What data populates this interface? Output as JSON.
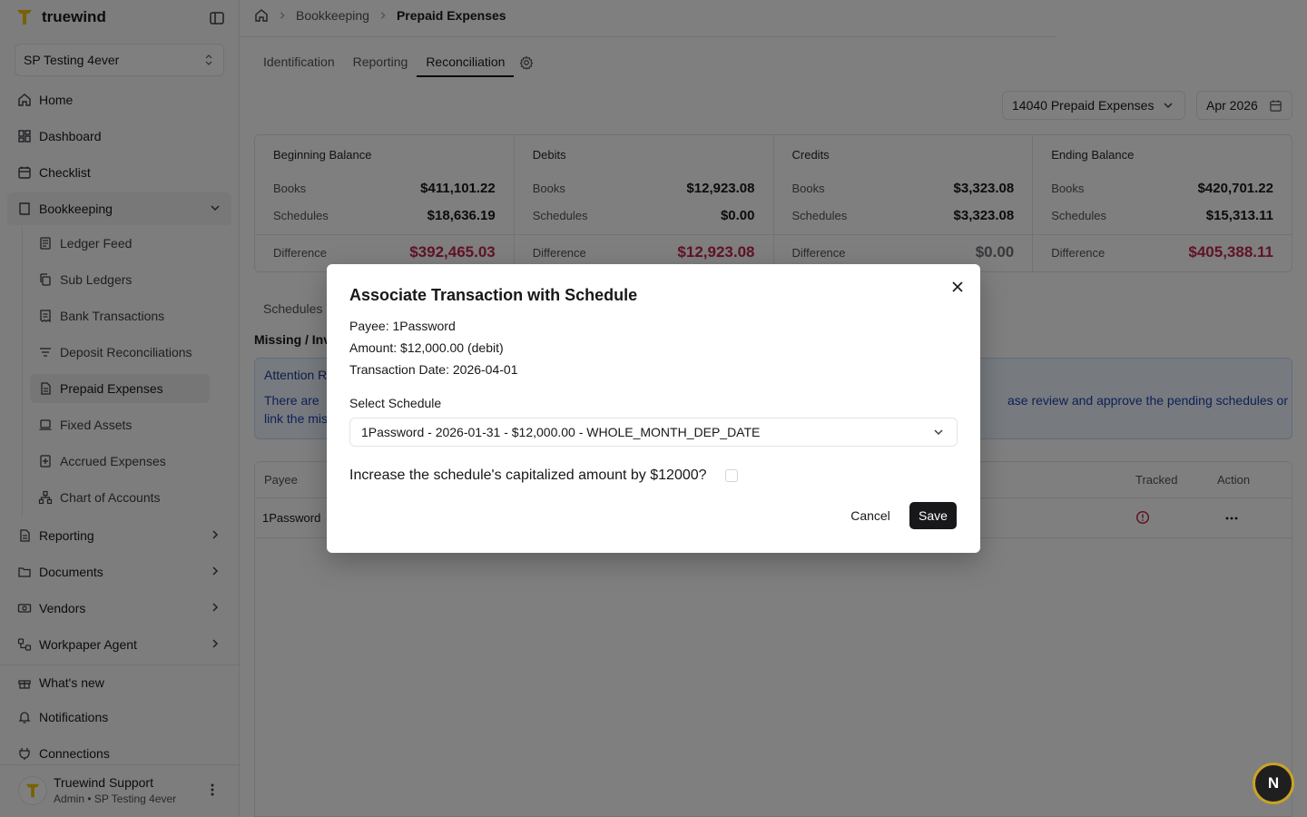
{
  "app": {
    "brand": "truewind"
  },
  "org_selector": {
    "value": "SP Testing 4ever"
  },
  "sidebar": {
    "items": [
      {
        "label": "Home",
        "icon": "home-icon"
      },
      {
        "label": "Dashboard",
        "icon": "dashboard-icon"
      },
      {
        "label": "Checklist",
        "icon": "calendar-icon"
      },
      {
        "label": "Bookkeeping",
        "icon": "book-icon"
      }
    ],
    "bookkeeping_sub": [
      {
        "label": "Ledger Feed"
      },
      {
        "label": "Sub Ledgers"
      },
      {
        "label": "Bank Transactions"
      },
      {
        "label": "Deposit Reconciliations"
      },
      {
        "label": "Prepaid Expenses"
      },
      {
        "label": "Fixed Assets"
      },
      {
        "label": "Accrued Expenses"
      },
      {
        "label": "Chart of Accounts"
      }
    ],
    "groups": [
      {
        "label": "Reporting"
      },
      {
        "label": "Documents"
      },
      {
        "label": "Vendors"
      },
      {
        "label": "Workpaper Agent"
      }
    ],
    "footer_items": [
      {
        "label": "What's new"
      },
      {
        "label": "Notifications"
      },
      {
        "label": "Connections"
      }
    ]
  },
  "user": {
    "name": "Truewind Support",
    "role": "Admin • SP Testing 4ever"
  },
  "breadcrumb": {
    "section": "Bookkeeping",
    "current": "Prepaid Expenses"
  },
  "tabs": [
    "Identification",
    "Reporting",
    "Reconciliation"
  ],
  "filters": {
    "account": "14040 Prepaid Expenses",
    "period": "Apr 2026"
  },
  "summary_cards": [
    {
      "title": "Beginning Balance",
      "books": "$411,101.22",
      "schedules": "$18,636.19",
      "difference": "$392,465.03",
      "diff_status": "red"
    },
    {
      "title": "Debits",
      "books": "$12,923.08",
      "schedules": "$0.00",
      "difference": "$12,923.08",
      "diff_status": "red"
    },
    {
      "title": "Credits",
      "books": "$3,323.08",
      "schedules": "$3,323.08",
      "difference": "$0.00",
      "diff_status": "zero"
    },
    {
      "title": "Ending Balance",
      "books": "$420,701.22",
      "schedules": "$15,313.11",
      "difference": "$405,388.11",
      "diff_status": "red"
    }
  ],
  "labels": {
    "books": "Books",
    "schedules": "Schedules",
    "difference": "Difference"
  },
  "section_tab": "Schedules",
  "missing_label": "Missing / Inv",
  "attention": {
    "title": "Attention R",
    "text_left": "There are",
    "text_left2": "link the mis",
    "text_right": "ase review and approve the pending schedules or"
  },
  "table": {
    "headers": {
      "payee": "Payee",
      "tracked": "Tracked",
      "action": "Action"
    },
    "rows": [
      {
        "payee": "1Password"
      }
    ]
  },
  "modal": {
    "title": "Associate Transaction with Schedule",
    "payee": "Payee: 1Password",
    "amount": "Amount: $12,000.00 (debit)",
    "date": "Transaction Date: 2026-04-01",
    "select_label": "Select Schedule",
    "select_value": "1Password - 2026-01-31 - $12,000.00 - WHOLE_MONTH_DEP_DATE",
    "checkbox_label": "Increase the schedule's capitalized amount by $12000?",
    "cancel": "Cancel",
    "save": "Save"
  },
  "fab": {
    "label": "N"
  },
  "colors": {
    "danger": "#c0264f",
    "brand": "#f2c200",
    "primary": "#18181b"
  }
}
